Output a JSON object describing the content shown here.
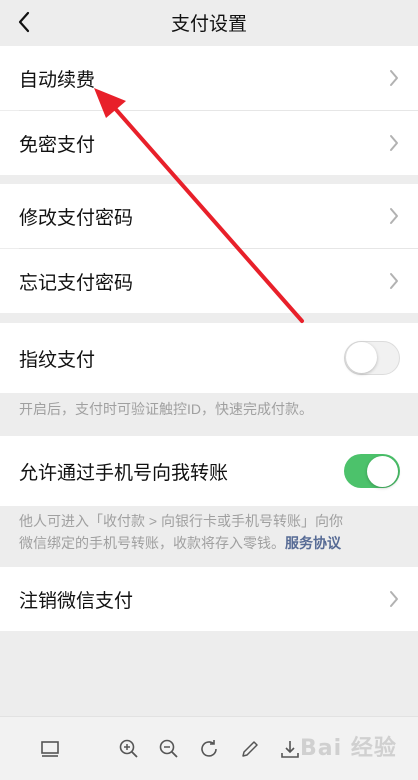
{
  "navbar": {
    "title": "支付设置"
  },
  "menu": {
    "auto_renew": "自动续费",
    "password_free": "免密支付",
    "change_password": "修改支付密码",
    "forgot_password": "忘记支付密码",
    "fingerprint_pay": "指纹支付",
    "phone_transfer": "允许通过手机号向我转账",
    "cancel_pay": "注销微信支付"
  },
  "toggles": {
    "fingerprint_pay": false,
    "phone_transfer": true
  },
  "notes": {
    "fingerprint": "开启后，支付时可验证触控ID，快速完成付款。",
    "phone_transfer_line1": "他人可进入「收付款 > 向银行卡或手机号转账」向你",
    "phone_transfer_line2": "微信绑定的手机号转账，收款将存入零钱。",
    "service_agreement": "服务协议"
  },
  "toolbar": {
    "icons": [
      "window-icon",
      "zoom-in-icon",
      "zoom-out-icon",
      "rotate-icon",
      "edit-icon",
      "download-icon"
    ]
  },
  "watermark": "Bai 经验",
  "colors": {
    "toggle_on": "#4cc26b",
    "link": "#576b95",
    "arrow": "#e8202a"
  }
}
